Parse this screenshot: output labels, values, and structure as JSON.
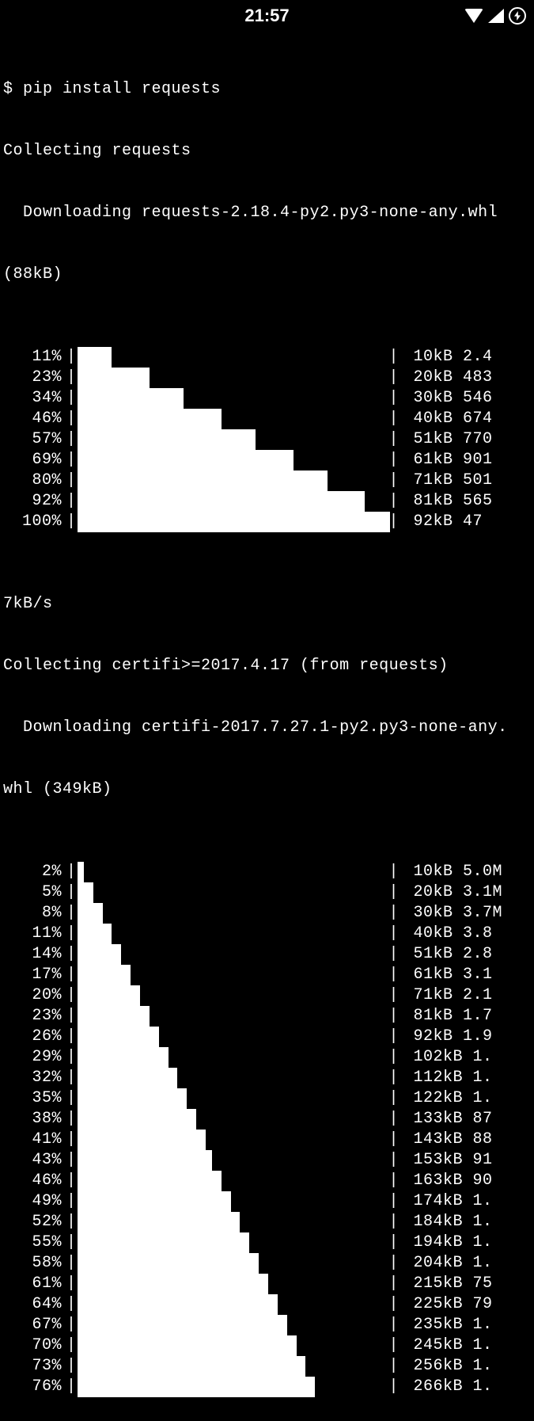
{
  "status_bar": {
    "time": "21:57"
  },
  "terminal": {
    "cmd_line": "$ pip install requests",
    "collect1": "Collecting requests",
    "download1a": "  Downloading requests-2.18.4-py2.py3-none-any.whl",
    "download1b": "(88kB)",
    "progress1": [
      {
        "pct": "11%",
        "fill": 11,
        "stats": " 10kB 2.4"
      },
      {
        "pct": "23%",
        "fill": 23,
        "stats": " 20kB 483"
      },
      {
        "pct": "34%",
        "fill": 34,
        "stats": " 30kB 546"
      },
      {
        "pct": "46%",
        "fill": 46,
        "stats": " 40kB 674"
      },
      {
        "pct": "57%",
        "fill": 57,
        "stats": " 51kB 770"
      },
      {
        "pct": "69%",
        "fill": 69,
        "stats": " 61kB 901"
      },
      {
        "pct": "80%",
        "fill": 80,
        "stats": " 71kB 501"
      },
      {
        "pct": "92%",
        "fill": 92,
        "stats": " 81kB 565"
      },
      {
        "pct": "100%",
        "fill": 100,
        "stats": " 92kB 47"
      }
    ],
    "wrap1": "7kB/s",
    "collect2": "Collecting certifi>=2017.4.17 (from requests)",
    "download2a": "  Downloading certifi-2017.7.27.1-py2.py3-none-any.",
    "download2b": "whl (349kB)",
    "progress2": [
      {
        "pct": "2%",
        "fill": 2,
        "stats": " 10kB 5.0M"
      },
      {
        "pct": "5%",
        "fill": 5,
        "stats": " 20kB 3.1M"
      },
      {
        "pct": "8%",
        "fill": 8,
        "stats": " 30kB 3.7M"
      },
      {
        "pct": "11%",
        "fill": 11,
        "stats": " 40kB 3.8"
      },
      {
        "pct": "14%",
        "fill": 14,
        "stats": " 51kB 2.8"
      },
      {
        "pct": "17%",
        "fill": 17,
        "stats": " 61kB 3.1"
      },
      {
        "pct": "20%",
        "fill": 20,
        "stats": " 71kB 2.1"
      },
      {
        "pct": "23%",
        "fill": 23,
        "stats": " 81kB 1.7"
      },
      {
        "pct": "26%",
        "fill": 26,
        "stats": " 92kB 1.9"
      },
      {
        "pct": "29%",
        "fill": 29,
        "stats": " 102kB 1."
      },
      {
        "pct": "32%",
        "fill": 32,
        "stats": " 112kB 1."
      },
      {
        "pct": "35%",
        "fill": 35,
        "stats": " 122kB 1."
      },
      {
        "pct": "38%",
        "fill": 38,
        "stats": " 133kB 87"
      },
      {
        "pct": "41%",
        "fill": 41,
        "stats": " 143kB 88"
      },
      {
        "pct": "43%",
        "fill": 43,
        "stats": " 153kB 91"
      },
      {
        "pct": "46%",
        "fill": 46,
        "stats": " 163kB 90"
      },
      {
        "pct": "49%",
        "fill": 49,
        "stats": " 174kB 1."
      },
      {
        "pct": "52%",
        "fill": 52,
        "stats": " 184kB 1."
      },
      {
        "pct": "55%",
        "fill": 55,
        "stats": " 194kB 1."
      },
      {
        "pct": "58%",
        "fill": 58,
        "stats": " 204kB 1."
      },
      {
        "pct": "61%",
        "fill": 61,
        "stats": " 215kB 75"
      },
      {
        "pct": "64%",
        "fill": 64,
        "stats": " 225kB 79"
      },
      {
        "pct": "67%",
        "fill": 67,
        "stats": " 235kB 1."
      },
      {
        "pct": "70%",
        "fill": 70,
        "stats": " 245kB 1."
      },
      {
        "pct": "73%",
        "fill": 73,
        "stats": " 256kB 1."
      },
      {
        "pct": "76%",
        "fill": 76,
        "stats": " 266kB 1."
      }
    ]
  }
}
